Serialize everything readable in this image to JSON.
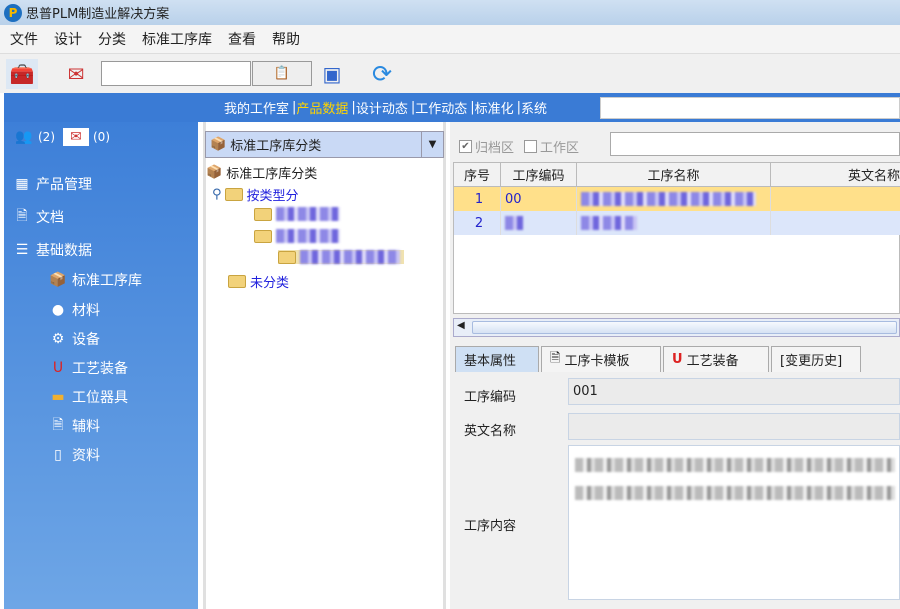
{
  "window": {
    "title": "思普PLM制造业解决方案"
  },
  "menu": [
    "文件",
    "设计",
    "分类",
    "标准工序库",
    "查看",
    "帮助"
  ],
  "nav": {
    "items": [
      {
        "label": "我的工作室"
      },
      {
        "label": "产品数据",
        "active": true
      },
      {
        "label": "设计动态"
      },
      {
        "label": "工作动态"
      },
      {
        "label": "标准化"
      },
      {
        "label": "系统"
      }
    ]
  },
  "sidebar": {
    "users_count": "(2)",
    "mail_count": "(0)",
    "sections": [
      "产品管理",
      "文档",
      "基础数据"
    ],
    "sub_items": [
      "标准工序库",
      "材料",
      "设备",
      "工艺装备",
      "工位器具",
      "辅料",
      "资料"
    ]
  },
  "tree": {
    "combo_value": "标准工序库分类",
    "root": "标准工序库分类",
    "nodes": [
      "按类型分",
      "未分类"
    ]
  },
  "filters": {
    "archive_label": "归档区",
    "archive_checked": true,
    "work_label": "工作区",
    "work_checked": false
  },
  "grid": {
    "columns": [
      "序号",
      "工序编码",
      "工序名称",
      "英文名称"
    ],
    "rows": [
      {
        "index": "1",
        "code": "00"
      },
      {
        "index": "2",
        "code": ""
      }
    ]
  },
  "tabs": [
    "基本属性",
    "工序卡模板",
    "工艺装备",
    "[变更历史]"
  ],
  "form": {
    "code_label": "工序编码",
    "code_value": "001",
    "english_label": "英文名称",
    "english_value": "",
    "content_label": "工序内容"
  },
  "colors": {
    "nav_blue": "#3a7bd5",
    "active_nav": "#ffd400",
    "selected_row": "#ffe08a"
  }
}
